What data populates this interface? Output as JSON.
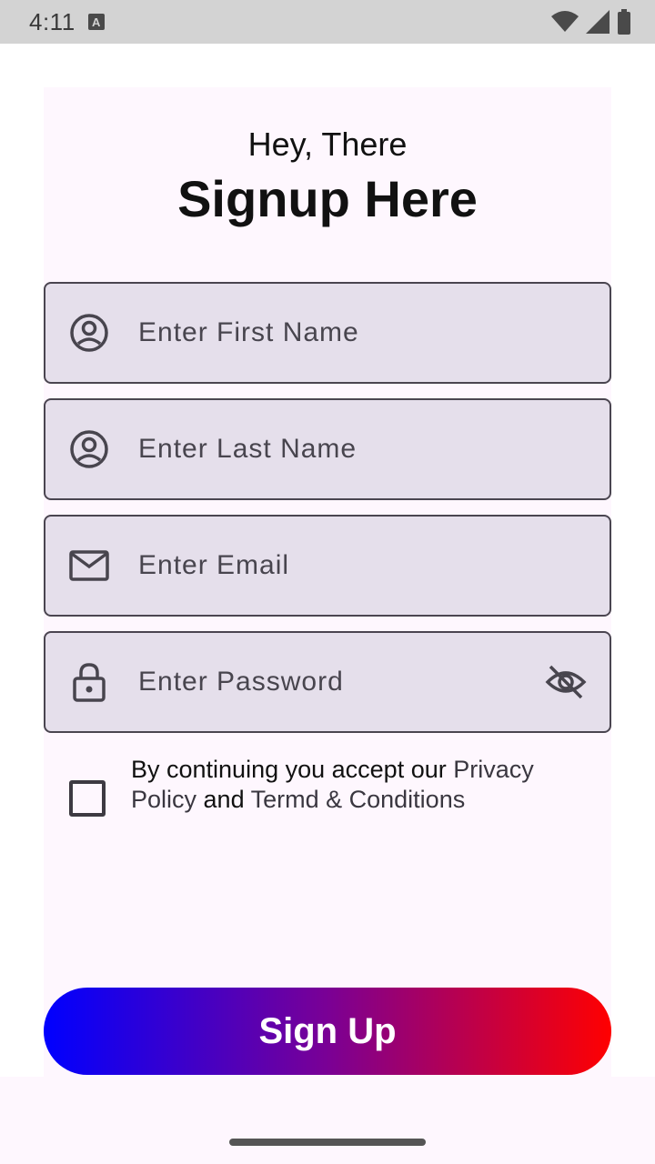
{
  "status_bar": {
    "time": "4:11",
    "notification_icon": "A",
    "icons": [
      "wifi-icon",
      "signal-icon",
      "battery-icon"
    ]
  },
  "header": {
    "greeting": "Hey, There",
    "title": "Signup Here"
  },
  "form": {
    "first_name": {
      "placeholder": "Enter First Name",
      "value": "",
      "icon": "account-circle-icon"
    },
    "last_name": {
      "placeholder": "Enter Last Name",
      "value": "",
      "icon": "account-circle-icon"
    },
    "email": {
      "placeholder": "Enter Email",
      "value": "",
      "icon": "mail-icon"
    },
    "password": {
      "placeholder": "Enter Password",
      "value": "",
      "icon": "lock-icon",
      "toggle_icon": "eye-off-icon"
    }
  },
  "consent": {
    "checked": false,
    "text_prefix": "By continuing you accept our ",
    "privacy_link": "Privacy Policy",
    "text_middle": " and ",
    "terms_link": "Termd & Conditions"
  },
  "actions": {
    "signup_label": "Sign Up"
  },
  "colors": {
    "gradient_start": "#0000ff",
    "gradient_end": "#ff0000",
    "field_bg": "#e5dfeb",
    "page_bg": "#fef7fe"
  }
}
